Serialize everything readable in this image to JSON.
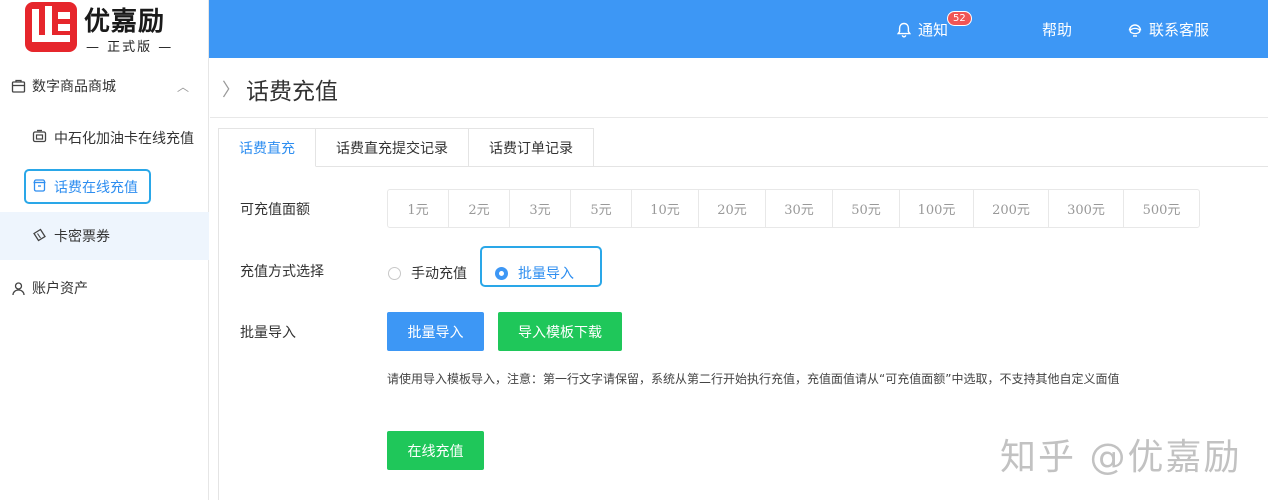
{
  "brand": {
    "name": "优嘉励",
    "edition": "— 正式版 —",
    "color": "#e6262c"
  },
  "header": {
    "notify_label": "通知",
    "notify_count": "52",
    "help_label": "帮助",
    "service_label": "联系客服",
    "bar_color": "#3d97f5"
  },
  "sidebar": {
    "group1": {
      "label": "数字商品商城",
      "icon": "store-icon"
    },
    "items": [
      {
        "label": "中石化加油卡在线充值",
        "icon": "fuel-card-icon"
      },
      {
        "label": "话费在线充值",
        "icon": "phone-bill-icon"
      },
      {
        "label": "卡密票券",
        "icon": "ticket-icon"
      }
    ],
    "group2": {
      "label": "账户资产",
      "icon": "user-icon"
    }
  },
  "page": {
    "title": "话费充值",
    "tabs": [
      "话费直充",
      "话费直充提交记录",
      "话费订单记录"
    ]
  },
  "form": {
    "amount_label": "可充值面额",
    "amounts": [
      "1元",
      "2元",
      "3元",
      "5元",
      "10元",
      "20元",
      "30元",
      "50元",
      "100元",
      "200元",
      "300元",
      "500元"
    ],
    "method_label": "充值方式选择",
    "method_manual": "手动充值",
    "method_batch": "批量导入",
    "batch_label": "批量导入",
    "batch_button": "批量导入",
    "template_button": "导入模板下载",
    "hint": "请使用导入模板导入，注意：第一行文字请保留，系统从第二行开始执行充值，充值面值请从“可充值面额”中选取，不支持其他自定义面值",
    "submit_button": "在线充值"
  },
  "watermark": "知乎 @优嘉励"
}
